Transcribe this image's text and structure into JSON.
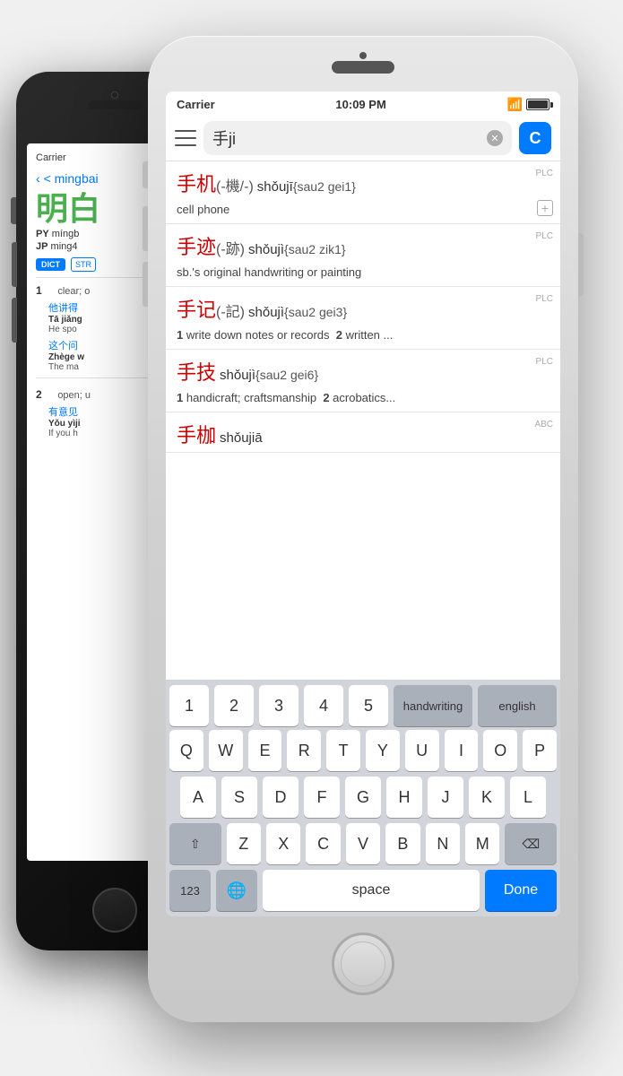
{
  "background": {
    "color": "#e8e8e8"
  },
  "black_phone": {
    "carrier": "Carrier",
    "back_label": "< mingbai",
    "title_chinese": "明白",
    "py_label": "PY",
    "py_value": "míngb",
    "jp_label": "JP",
    "jp_value": "ming4",
    "dict_badge": "DICT",
    "str_badge": "STR",
    "def1_num": "1",
    "def1_text": "clear; o",
    "example1_cn": "他讲得",
    "example1_py": "Tā jiǎng",
    "example1_en": "He spo",
    "example2_cn": "这个问",
    "example2_py": "Zhège w",
    "example2_en": "The ma",
    "def2_num": "2",
    "def2_text": "open; u",
    "example3_cn": "有意见",
    "example3_py": "Yǒu yìji",
    "example3_en": "If you h"
  },
  "white_phone": {
    "status": {
      "carrier": "Carrier",
      "time": "10:09 PM"
    },
    "search": {
      "placeholder": "手ji",
      "c_btn": "C"
    },
    "results": [
      {
        "chinese": "手机",
        "trad": "(-機/-)",
        "pinyin": "shǒujī",
        "cantonese": "{sau2 gei1}",
        "definition": "cell phone",
        "badge": "PLC",
        "has_plus": true
      },
      {
        "chinese": "手迹",
        "trad": "(-跡)",
        "pinyin": "shǒujì",
        "cantonese": "{sau2 zik1}",
        "definition": "sb.'s original handwriting or painting",
        "badge": "PLC",
        "has_plus": false
      },
      {
        "chinese": "手记",
        "trad": "(-記)",
        "pinyin": "shǒujì",
        "cantonese": "{sau2 gei3}",
        "definition": "1 write down notes or records  2 written ...",
        "badge": "PLC",
        "has_plus": false
      },
      {
        "chinese": "手技",
        "trad": "",
        "pinyin": "shǒujì",
        "cantonese": "{sau2 gei6}",
        "definition": "1 handicraft; craftsmanship  2 acrobatics...",
        "badge": "PLC",
        "has_plus": false
      },
      {
        "chinese": "手枷",
        "trad": "",
        "pinyin": "shǒujiā",
        "cantonese": "",
        "definition": "",
        "badge": "ABC",
        "has_plus": false
      }
    ],
    "keyboard": {
      "row1": [
        "1",
        "2",
        "3",
        "4",
        "5"
      ],
      "row1_modes": [
        "handwriting",
        "english"
      ],
      "row2": [
        "Q",
        "W",
        "E",
        "R",
        "T",
        "Y",
        "U",
        "I",
        "O",
        "P"
      ],
      "row3": [
        "A",
        "S",
        "D",
        "F",
        "G",
        "H",
        "J",
        "K",
        "L"
      ],
      "row4": [
        "Z",
        "X",
        "C",
        "V",
        "B",
        "N",
        "M"
      ],
      "space_label": "space",
      "done_label": "Done",
      "num_label": "123"
    }
  }
}
